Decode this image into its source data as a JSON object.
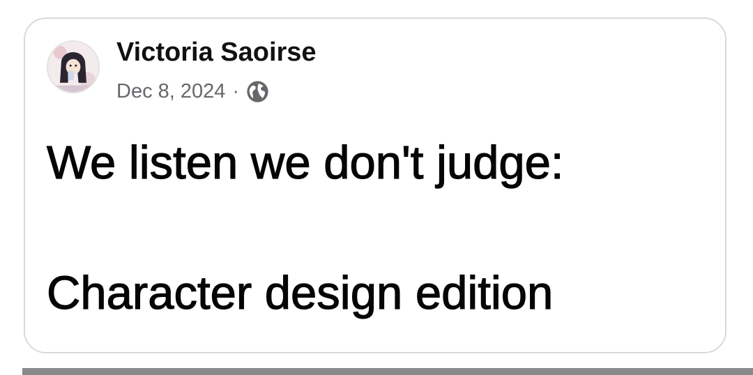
{
  "post": {
    "author": "Victoria Saoirse",
    "date": "Dec 8, 2024",
    "separator": "·",
    "privacy_icon": "globe-icon",
    "lines": [
      "We listen we don't judge:",
      "Character design edition"
    ]
  },
  "colors": {
    "card_border": "#d9d9d9",
    "meta_text": "#65676b",
    "post_text": "#050505",
    "bottom_bar": "#8a8a8a"
  }
}
